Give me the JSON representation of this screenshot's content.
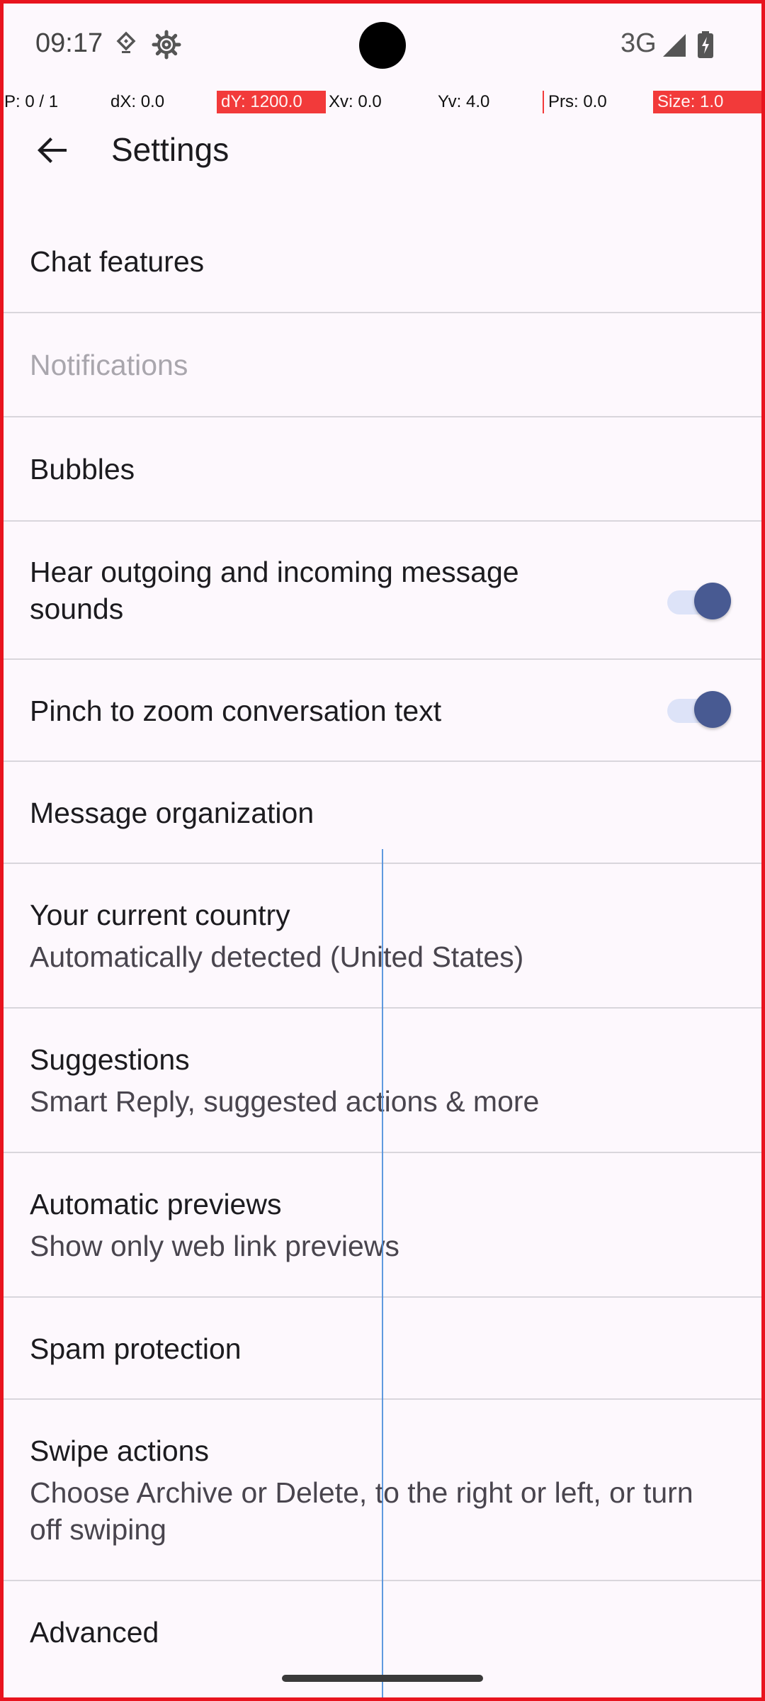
{
  "status": {
    "time": "09:17",
    "network": "3G"
  },
  "debug": {
    "p": "P: 0 / 1",
    "dx": "dX: 0.0",
    "dy": "dY: 1200.0",
    "xv": "Xv: 0.0",
    "yv": "Yv: 4.0",
    "prs": "Prs: 0.0",
    "size": "Size: 1.0"
  },
  "appbar": {
    "title": "Settings"
  },
  "settings": {
    "items": [
      {
        "title": "Chat features"
      },
      {
        "title": "Notifications"
      },
      {
        "title": "Bubbles"
      },
      {
        "title": "Hear outgoing and incoming message sounds",
        "toggle": true
      },
      {
        "title": "Pinch to zoom conversation text",
        "toggle": true
      },
      {
        "title": "Message organization"
      },
      {
        "title": "Your current country",
        "subtitle": "Automatically detected (United States)"
      },
      {
        "title": "Suggestions",
        "subtitle": "Smart Reply, suggested actions & more"
      },
      {
        "title": "Automatic previews",
        "subtitle": "Show only web link previews"
      },
      {
        "title": "Spam protection"
      },
      {
        "title": "Swipe actions",
        "subtitle": "Choose Archive or Delete, to the right or left, or turn off swiping"
      },
      {
        "title": "Advanced"
      }
    ]
  },
  "colors": {
    "accent": "#485a92",
    "track": "#dde3f8",
    "frame": "#e8141e",
    "background": "#fdf8fd"
  }
}
